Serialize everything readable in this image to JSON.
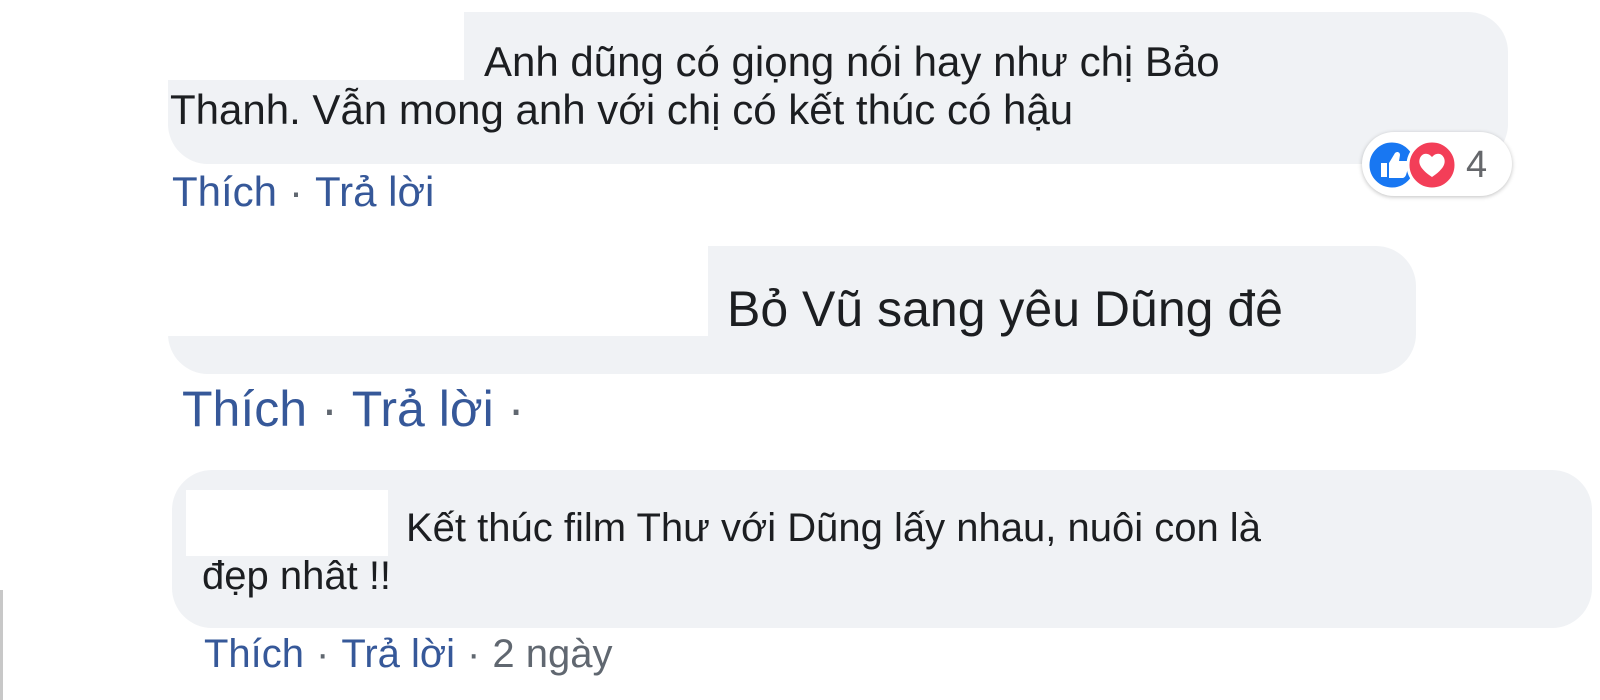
{
  "comments": [
    {
      "line1": "Anh dũng có giọng nói hay như chị Bảo",
      "line2": "Thanh. Vẫn mong anh với chị có kết thúc có hậu",
      "actions": [
        "Thích",
        "Trả lời"
      ],
      "reactions": {
        "icons": [
          "like-icon",
          "love-icon"
        ],
        "count": "4"
      }
    },
    {
      "line1": "Bỏ Vũ sang yêu Dũng đê",
      "actions": [
        "Thích",
        "Trả lời"
      ],
      "trailing_separator": "·"
    },
    {
      "line1": "Kết thúc film Thư với Dũng lấy nhau, nuôi con là",
      "line2": "đẹp nhât !!",
      "actions": [
        "Thích",
        "Trả lời"
      ],
      "timestamp": "2 ngày"
    }
  ],
  "separator": "·",
  "colors": {
    "bubble": "#f0f2f5",
    "link": "#365899",
    "text": "#1c1e21",
    "muted": "#606770",
    "like": "#1877f2",
    "love": "#f33e58"
  }
}
